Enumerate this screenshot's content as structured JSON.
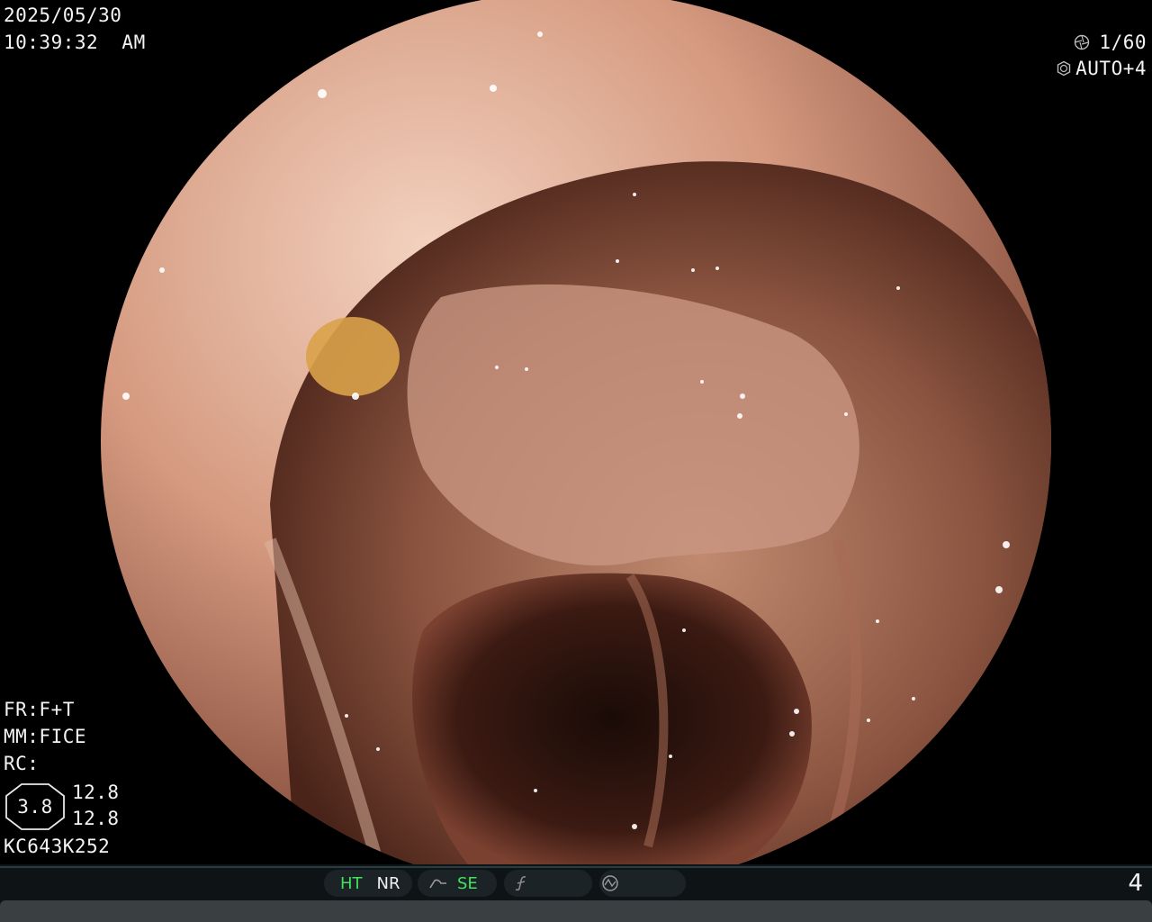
{
  "overlay": {
    "date": "2025/05/30",
    "time": "10:39:32  AM",
    "shutter": "1/60",
    "iris": "AUTO+4",
    "frame_mode": "FR:F+T",
    "mm_mode": "MM:FICE",
    "rc": "RC:",
    "octagon_value": "3.8",
    "value_top": "12.8",
    "value_bottom": "12.8",
    "scope_id": "KC643K252"
  },
  "status_bar": {
    "ht": "HT",
    "nr": "NR",
    "se": "SE",
    "page": "4"
  },
  "colors": {
    "active_green": "#41e35a",
    "bar_bg": "#0e1416",
    "pill_bg": "#1b2327"
  },
  "icons": {
    "shutter": "aperture-icon",
    "iris": "iris-icon",
    "curve": "tone-curve-icon",
    "function": "function-icon",
    "circle": "circle-wave-icon"
  }
}
